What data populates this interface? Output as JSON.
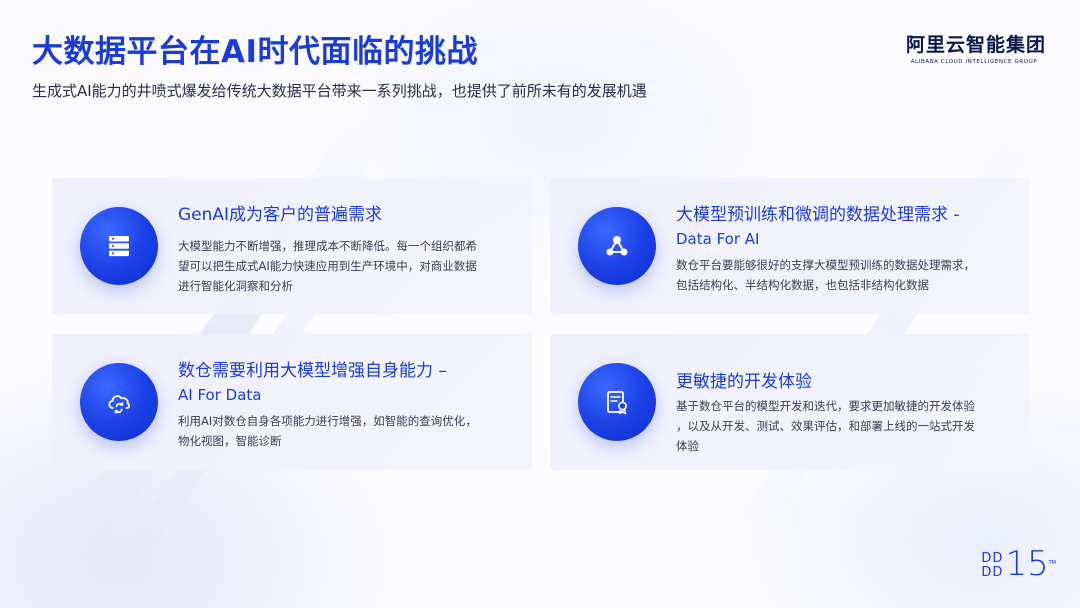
{
  "header": {
    "title": "大数据平台在AI时代面临的挑战",
    "subtitle": "生成式AI能力的井喷式爆发给传统大数据平台带来一系列挑战，也提供了前所未有的发展机遇"
  },
  "logo": {
    "cn": "阿里云智能集团",
    "en": "ALIBABA CLOUD INTELLIGENCE GROUP"
  },
  "cards": [
    {
      "icon": "server-stack-icon",
      "title_lines": [
        "GenAI成为客户的普遍需求"
      ],
      "desc_lines": [
        "大模型能力不断增强，推理成本不断降低。每一个组织都希",
        "望可以把生成式AI能力快速应用到生产环境中，对商业数据",
        "进行智能化洞察和分析"
      ]
    },
    {
      "icon": "network-nodes-icon",
      "title_lines": [
        "大模型预训练和微调的数据处理需求 -",
        "Data For AI"
      ],
      "desc_lines": [
        "数仓平台要能够很好的支撑大模型预训练的数据处理需求，",
        "包括结构化、半结构化数据，也包括非结构化数据"
      ]
    },
    {
      "icon": "cloud-sync-icon",
      "title_lines": [
        "数仓需要利用大模型增强自身能力 –",
        "AI For Data"
      ],
      "desc_lines": [
        "利用AI对数仓自身各项能力进行增强，如智能的查询优化，",
        "物化视图，智能诊断"
      ]
    },
    {
      "icon": "certificate-document-icon",
      "title_lines": [
        "更敏捷的开发体验"
      ],
      "desc_lines": [
        "基于数仓平台的模型开发和迭代，要求更加敏捷的开发体验",
        "，以及从开发、测试、效果评估，和部署上线的一站式开发",
        "体验"
      ]
    }
  ],
  "event_logo": {
    "top": "DD",
    "bottom": "DD",
    "number": "15",
    "mark": "TM"
  },
  "colors": {
    "accent": "#1a3bd6",
    "icon_blue": "#1a3fe6",
    "card_bg": "#eeeffc",
    "body_text": "#3a3d55"
  }
}
